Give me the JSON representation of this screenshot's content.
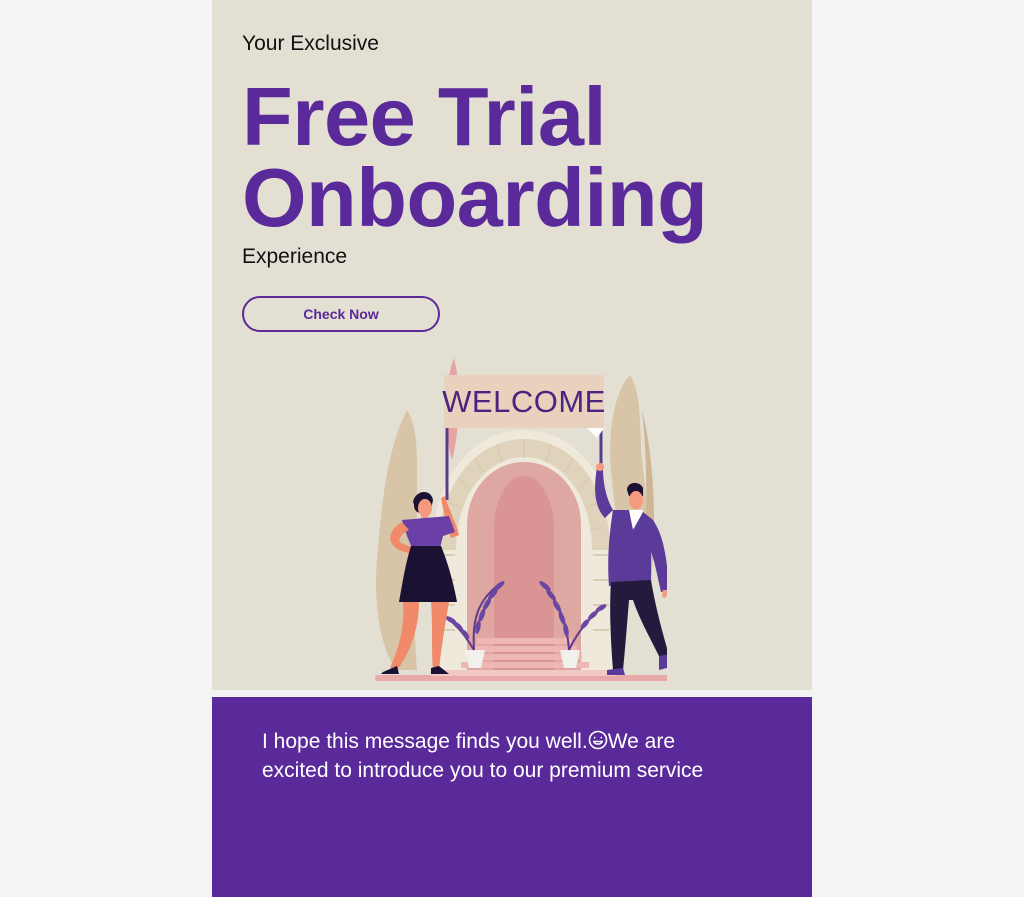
{
  "hero": {
    "eyebrow": "Your Exclusive",
    "headline_line1": "Free Trial",
    "headline_line2": "Onboarding",
    "subline": "Experience",
    "cta_label": "Check Now",
    "sign_text": "WELCOME",
    "icon": "welcome-illustration"
  },
  "message": {
    "text_before_emoji": "I hope this message finds you well.",
    "emoji": "smiling-face-with-heart-eyes-icon",
    "text_after_emoji": "We are excited to introduce you to our premium service"
  },
  "colors": {
    "page_bg": "#f4f4f4",
    "hero_bg": "#e3dfd2",
    "brand_purple": "#5b2a9a",
    "text_dark": "#111111",
    "white": "#ffffff"
  }
}
